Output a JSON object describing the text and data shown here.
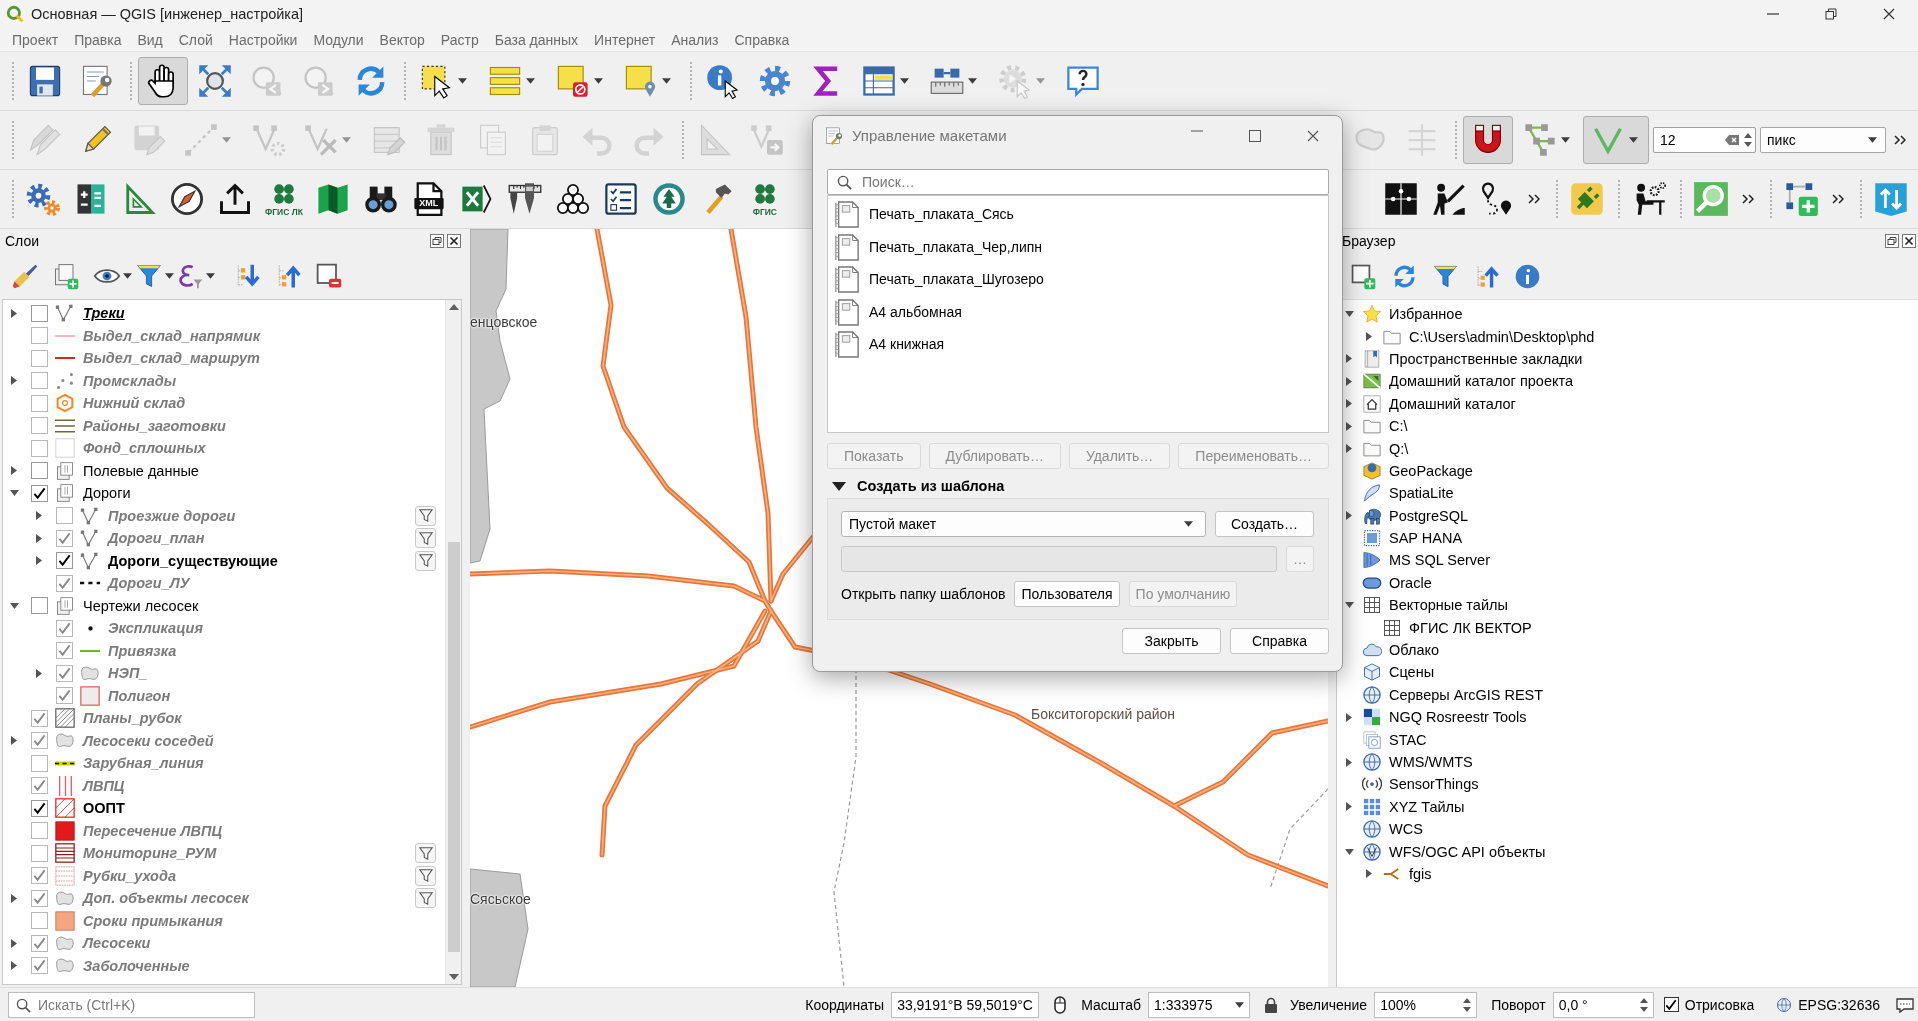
{
  "window": {
    "title": "Основная — QGIS [инженер_настройка]"
  },
  "menu": [
    "Проект",
    "Правка",
    "Вид",
    "Слой",
    "Настройки",
    "Модули",
    "Вектор",
    "Растр",
    "База данных",
    "Интернет",
    "Анализ",
    "Справка"
  ],
  "toolbars": [
    {
      "groups": [
        {
          "buttons": [
            {
              "pressed": false,
              "disabled": false
            },
            {
              "pressed": false,
              "disabled": false
            }
          ]
        },
        {
          "buttons": [
            {
              "pressed": true,
              "disabled": false
            },
            {
              "pressed": false,
              "disabled": false
            },
            {
              "pressed": false,
              "disabled": true
            },
            {
              "pressed": false,
              "disabled": true
            },
            {
              "pressed": false,
              "disabled": false
            }
          ]
        },
        {
          "buttons": [
            {
              "pressed": false,
              "disabled": false
            },
            {
              "pressed": false,
              "disabled": false
            },
            {
              "pressed": false,
              "disabled": false
            },
            {
              "pressed": false,
              "disabled": false
            }
          ]
        },
        {
          "buttons": [
            {
              "pressed": false,
              "disabled": false
            },
            {
              "pressed": false,
              "disabled": false
            },
            {
              "pressed": false,
              "disabled": false
            },
            {
              "pressed": false,
              "disabled": false
            },
            {
              "pressed": false,
              "disabled": false
            },
            {
              "pressed": false,
              "disabled": true
            },
            {
              "pressed": false,
              "disabled": false
            }
          ]
        }
      ]
    },
    {
      "groups": [
        {
          "buttons": [
            {
              "pressed": false,
              "disabled": true
            },
            {
              "pressed": false,
              "disabled": false
            },
            {
              "pressed": false,
              "disabled": true
            },
            {
              "pressed": false,
              "disabled": true
            },
            {
              "pressed": false,
              "disabled": true
            },
            {
              "pressed": false,
              "disabled": true
            },
            {
              "pressed": false,
              "disabled": true
            },
            {
              "pressed": false,
              "disabled": true
            },
            {
              "pressed": false,
              "disabled": true
            },
            {
              "pressed": false,
              "disabled": true
            },
            {
              "pressed": false,
              "disabled": true
            },
            {
              "pressed": false,
              "disabled": true
            }
          ]
        },
        {
          "buttons": [
            {
              "pressed": false,
              "disabled": true
            },
            {
              "pressed": false,
              "disabled": true
            }
          ]
        },
        {
          "buttons": [
            {
              "pressed": false,
              "disabled": true
            },
            {
              "pressed": false,
              "disabled": true
            }
          ]
        },
        {
          "buttons": [
            {
              "pressed": true,
              "disabled": false
            },
            {
              "pressed": false,
              "disabled": false
            },
            {
              "pressed": true,
              "disabled": false
            }
          ]
        }
      ],
      "tolerance": {
        "value": "12"
      },
      "units": {
        "value": "пикс"
      }
    },
    {
      "groups": [
        {
          "buttons": [
            {
              "pressed": false,
              "disabled": false
            },
            {
              "pressed": false,
              "disabled": false
            },
            {
              "pressed": false,
              "disabled": false
            },
            {
              "pressed": false,
              "disabled": false
            },
            {
              "pressed": false,
              "disabled": false
            },
            {
              "pressed": false,
              "disabled": false,
              "label": "ФГИС ЛК"
            },
            {
              "pressed": false,
              "disabled": false
            },
            {
              "pressed": false,
              "disabled": false
            },
            {
              "pressed": false,
              "disabled": false,
              "badge": "XML"
            },
            {
              "pressed": false,
              "disabled": false
            },
            {
              "pressed": false,
              "disabled": false
            },
            {
              "pressed": false,
              "disabled": false
            },
            {
              "pressed": false,
              "disabled": false
            },
            {
              "pressed": false,
              "disabled": false
            },
            {
              "pressed": false,
              "disabled": false
            },
            {
              "pressed": false,
              "disabled": false,
              "label": "ФГИС"
            }
          ]
        },
        {
          "buttons": [
            {
              "pressed": false,
              "disabled": false
            },
            {
              "pressed": false,
              "disabled": false
            },
            {
              "pressed": false,
              "disabled": false
            }
          ]
        },
        {
          "buttons": [
            {
              "pressed": false,
              "disabled": false
            }
          ]
        },
        {
          "buttons": [
            {
              "pressed": false,
              "disabled": false
            }
          ]
        },
        {
          "buttons": [
            {
              "pressed": false,
              "disabled": false
            }
          ]
        },
        {
          "buttons": [
            {
              "pressed": false,
              "disabled": false
            }
          ]
        },
        {
          "buttons": [
            {
              "pressed": false,
              "disabled": false
            }
          ]
        }
      ]
    }
  ],
  "layers_panel": {
    "title": "Слои",
    "layers": [
      {
        "name": "Треки",
        "bold": true,
        "italic": true,
        "dimmed": false,
        "underlined": true,
        "checked": false,
        "expanded": false,
        "filtered": false
      },
      {
        "name": "Выдел_склад_напрямик",
        "bold": true,
        "italic": true,
        "dimmed": true,
        "underlined": false,
        "checked": false,
        "filtered": false
      },
      {
        "name": "Выдел_склад_маршрут",
        "bold": true,
        "italic": true,
        "dimmed": true,
        "underlined": false,
        "checked": false,
        "filtered": false
      },
      {
        "name": "Промсклады",
        "bold": true,
        "italic": true,
        "dimmed": true,
        "underlined": false,
        "checked": false,
        "expanded": false,
        "filtered": false
      },
      {
        "name": "Нижний склад",
        "bold": true,
        "italic": true,
        "dimmed": true,
        "underlined": false,
        "checked": false,
        "filtered": false
      },
      {
        "name": "Районы_заготовки",
        "bold": true,
        "italic": true,
        "dimmed": true,
        "underlined": false,
        "checked": false,
        "filtered": false
      },
      {
        "name": "Фонд_сплошных",
        "bold": true,
        "italic": true,
        "dimmed": true,
        "underlined": false,
        "checked": false,
        "filtered": false
      },
      {
        "name": "Полевые данные",
        "bold": false,
        "italic": false,
        "dimmed": false,
        "underlined": false,
        "checked": false,
        "expanded": false,
        "filtered": false
      },
      {
        "name": "Дороги",
        "bold": false,
        "italic": false,
        "dimmed": false,
        "underlined": false,
        "checked": true,
        "expanded": true,
        "filtered": false,
        "children": [
          {
            "name": "Проезжие дороги",
            "bold": true,
            "italic": true,
            "dimmed": true,
            "underlined": false,
            "checked": false,
            "expanded": false,
            "filtered": true
          },
          {
            "name": "Дороги_план",
            "bold": true,
            "italic": true,
            "dimmed": true,
            "underlined": false,
            "checked": true,
            "expanded": false,
            "filtered": true
          },
          {
            "name": "Дороги_существующие",
            "bold": true,
            "italic": false,
            "dimmed": false,
            "underlined": false,
            "checked": true,
            "expanded": false,
            "filtered": true
          },
          {
            "name": "Дороги_ЛУ",
            "bold": true,
            "italic": true,
            "dimmed": true,
            "underlined": false,
            "checked": true,
            "filtered": false
          }
        ]
      },
      {
        "name": "Чертежи лесосек",
        "bold": false,
        "italic": false,
        "dimmed": false,
        "underlined": false,
        "checked": false,
        "expanded": true,
        "filtered": false,
        "children": [
          {
            "name": "Экспликация",
            "bold": true,
            "italic": true,
            "dimmed": true,
            "underlined": false,
            "checked": true,
            "filtered": false
          },
          {
            "name": "Привязка",
            "bold": true,
            "italic": true,
            "dimmed": true,
            "underlined": false,
            "checked": true,
            "filtered": false
          },
          {
            "name": "НЭП_",
            "bold": true,
            "italic": true,
            "dimmed": true,
            "underlined": false,
            "checked": true,
            "expanded": false,
            "filtered": false
          },
          {
            "name": "Полигон",
            "bold": true,
            "italic": true,
            "dimmed": true,
            "underlined": false,
            "checked": true,
            "filtered": false
          }
        ]
      },
      {
        "name": "Планы_рубок",
        "bold": true,
        "italic": true,
        "dimmed": true,
        "underlined": false,
        "checked": true,
        "filtered": false
      },
      {
        "name": "Лесосеки соседей",
        "bold": true,
        "italic": true,
        "dimmed": true,
        "underlined": false,
        "checked": true,
        "expanded": false,
        "filtered": false
      },
      {
        "name": "Зарубная_линия",
        "bold": true,
        "italic": true,
        "dimmed": true,
        "underlined": false,
        "checked": false,
        "filtered": false
      },
      {
        "name": "ЛВПЦ",
        "bold": true,
        "italic": true,
        "dimmed": true,
        "underlined": false,
        "checked": true,
        "filtered": false
      },
      {
        "name": "ООПТ",
        "bold": true,
        "italic": false,
        "dimmed": false,
        "underlined": false,
        "checked": true,
        "filtered": false
      },
      {
        "name": "Пересечение ЛВПЦ",
        "bold": true,
        "italic": true,
        "dimmed": true,
        "underlined": false,
        "checked": false,
        "filtered": false
      },
      {
        "name": "Мониторинг_РУМ",
        "bold": true,
        "italic": true,
        "dimmed": true,
        "underlined": false,
        "checked": false,
        "filtered": true
      },
      {
        "name": "Рубки_ухода",
        "bold": true,
        "italic": true,
        "dimmed": true,
        "underlined": false,
        "checked": true,
        "filtered": true
      },
      {
        "name": "Доп. объекты лесосек",
        "bold": true,
        "italic": true,
        "dimmed": true,
        "underlined": false,
        "checked": true,
        "expanded": false,
        "filtered": true
      },
      {
        "name": "Сроки примыкания",
        "bold": true,
        "italic": true,
        "dimmed": true,
        "underlined": false,
        "checked": false,
        "filtered": false
      },
      {
        "name": "Лесосеки",
        "bold": true,
        "italic": true,
        "dimmed": true,
        "underlined": false,
        "checked": true,
        "expanded": false,
        "filtered": false
      },
      {
        "name": "Заболоченные",
        "bold": true,
        "italic": true,
        "dimmed": true,
        "underlined": false,
        "checked": true,
        "expanded": false,
        "filtered": false
      }
    ]
  },
  "map": {
    "labels": [
      {
        "text": "енцовское"
      },
      {
        "text": "Сясьское"
      },
      {
        "text": "Бокситогорский район"
      }
    ]
  },
  "browser_panel": {
    "title": "Браузер",
    "items": [
      {
        "label": "Избранное",
        "expanded": true,
        "children": [
          {
            "label": "C:\\Users\\admin\\Desktop\\phd",
            "expanded": false
          }
        ]
      },
      {
        "label": "Пространственные закладки",
        "expanded": false
      },
      {
        "label": "Домашний каталог проекта",
        "expanded": false
      },
      {
        "label": "Домашний каталог",
        "expanded": false
      },
      {
        "label": "C:\\",
        "expanded": false
      },
      {
        "label": "Q:\\",
        "expanded": false
      },
      {
        "label": "GeoPackage"
      },
      {
        "label": "SpatiaLite"
      },
      {
        "label": "PostgreSQL",
        "expanded": false
      },
      {
        "label": "SAP HANA"
      },
      {
        "label": "MS SQL Server"
      },
      {
        "label": "Oracle"
      },
      {
        "label": "Векторные тайлы",
        "expanded": true,
        "children": [
          {
            "label": "ФГИС ЛК ВЕКТОР"
          }
        ]
      },
      {
        "label": "Облако"
      },
      {
        "label": "Сцены"
      },
      {
        "label": "Серверы ArcGIS REST"
      },
      {
        "label": "NGQ Rosreestr Tools",
        "expanded": false
      },
      {
        "label": "STAC"
      },
      {
        "label": "WMS/WMTS",
        "expanded": false
      },
      {
        "label": "SensorThings"
      },
      {
        "label": "XYZ Тайлы",
        "expanded": false
      },
      {
        "label": "WCS"
      },
      {
        "label": "WFS/OGC API объекты",
        "expanded": true,
        "children": [
          {
            "label": "fgis",
            "expanded": false
          }
        ]
      }
    ]
  },
  "status_bar": {
    "search": {
      "placeholder": "Искать (Ctrl+K)"
    },
    "coordinates": {
      "label": "Координаты",
      "value": "33,9191°В 59,5019°С"
    },
    "scale": {
      "label": "Масштаб",
      "value": "1:333975"
    },
    "magnifier": {
      "label": "Увеличение",
      "value": "100%"
    },
    "rotation": {
      "label": "Поворот",
      "value": "0,0 °"
    },
    "render": {
      "label": "Отрисовка",
      "checked": true
    },
    "crs": "EPSG:32636"
  },
  "layout_manager": {
    "title": "Управление макетами",
    "search": {
      "placeholder": "Поиск…"
    },
    "layouts": [
      {
        "name": "Печать_плаката_Сясь",
        "selected": false
      },
      {
        "name": "Печать_плаката_Чер,липн",
        "selected": false
      },
      {
        "name": "Печать_плаката_Шугозеро",
        "selected": false
      },
      {
        "name": "А4 альбомная",
        "selected": false
      },
      {
        "name": "А4 книжная",
        "selected": false
      }
    ],
    "buttons": [
      {
        "label": "Показать",
        "disabled": true
      },
      {
        "label": "Дублировать…",
        "disabled": true
      },
      {
        "label": "Удалить…",
        "disabled": true
      },
      {
        "label": "Переименовать…",
        "disabled": true
      }
    ],
    "template_section": {
      "title": "Создать из шаблона",
      "expanded": true,
      "template": {
        "value": "Пустой макет"
      },
      "create_button": {
        "label": "Создать…",
        "disabled": false
      },
      "path_field": {
        "disabled": true
      },
      "browse_button": {
        "label": "…",
        "disabled": true
      },
      "open_folder": {
        "label": "Открыть папку шаблонов",
        "buttons": [
          {
            "label": "Пользователя",
            "disabled": false
          },
          {
            "label": "По умолчанию",
            "disabled": true
          }
        ]
      }
    },
    "footer_buttons": [
      {
        "label": "Закрыть"
      },
      {
        "label": "Справка"
      }
    ]
  }
}
